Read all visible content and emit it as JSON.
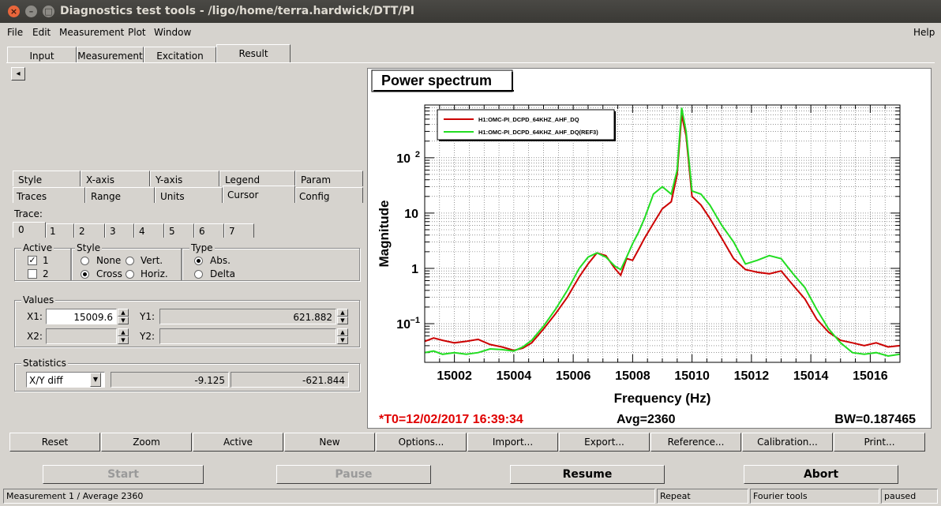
{
  "window": {
    "title": "Diagnostics test tools - /ligo/home/terra.hardwick/DTT/PI"
  },
  "menu": {
    "file": "File",
    "edit": "Edit",
    "measurement": "Measurement",
    "plot": "Plot",
    "window": "Window",
    "help": "Help"
  },
  "main_tabs": [
    "Input",
    "Measurement",
    "Excitation",
    "Result"
  ],
  "left_arrow": "◂",
  "sub_tabs_row1": [
    "Style",
    "X-axis",
    "Y-axis",
    "Legend",
    "Param"
  ],
  "sub_tabs_row2": [
    "Traces",
    "Range",
    "Units",
    "Cursor",
    "Config"
  ],
  "trace": {
    "label": "Trace:",
    "tabs": [
      "0",
      "1",
      "2",
      "3",
      "4",
      "5",
      "6",
      "7"
    ]
  },
  "active": {
    "label": "Active",
    "items": [
      "1",
      "2"
    ]
  },
  "style": {
    "label": "Style",
    "none": "None",
    "vert": "Vert.",
    "cross": "Cross",
    "horiz": "Horiz."
  },
  "type": {
    "label": "Type",
    "abs": "Abs.",
    "delta": "Delta"
  },
  "values": {
    "label": "Values",
    "x1_label": "X1:",
    "x1": "15009.6",
    "y1_label": "Y1:",
    "y1": "621.882",
    "x2_label": "X2:",
    "y2_label": "Y2:"
  },
  "statistics": {
    "label": "Statistics",
    "select": "X/Y diff",
    "v1": "-9.125",
    "v2": "-621.844"
  },
  "chart_data": {
    "type": "line",
    "title": "Power spectrum",
    "xlabel": "Frequency (Hz)",
    "ylabel": "Magnitude",
    "xlim": [
      15001,
      15017
    ],
    "ylim": [
      0.02,
      900
    ],
    "yscale": "log",
    "grid": true,
    "legend_position": "top-left",
    "x_ticks": [
      "15002",
      "15004",
      "15006",
      "15008",
      "15010",
      "15012",
      "15014",
      "15016"
    ],
    "y_ticks": [
      {
        "value": 0.1,
        "base": "10",
        "exp": "−1"
      },
      {
        "value": 1,
        "base": "1",
        "exp": ""
      },
      {
        "value": 10,
        "base": "10",
        "exp": ""
      },
      {
        "value": 100,
        "base": "10",
        "exp": "2"
      }
    ],
    "series": [
      {
        "name": "H1:OMC-PI_DCPD_64KHZ_AHF_DQ",
        "color": "#cc0000",
        "x": [
          15001,
          15001.3,
          15001.6,
          15002,
          15002.4,
          15002.8,
          15003.2,
          15003.6,
          15004,
          15004.3,
          15004.6,
          15005,
          15005.4,
          15005.8,
          15006.2,
          15006.5,
          15006.8,
          15007.1,
          15007.4,
          15007.6,
          15007.8,
          15008,
          15008.2,
          15008.4,
          15008.7,
          15009,
          15009.3,
          15009.5,
          15009.65,
          15009.8,
          15010,
          15010.3,
          15010.6,
          15011,
          15011.4,
          15011.8,
          15012.2,
          15012.6,
          15013,
          15013.4,
          15013.8,
          15014.2,
          15014.6,
          15015,
          15015.4,
          15015.8,
          15016.2,
          15016.6,
          15017
        ],
        "y": [
          0.048,
          0.055,
          0.05,
          0.045,
          0.048,
          0.052,
          0.042,
          0.038,
          0.033,
          0.036,
          0.045,
          0.08,
          0.15,
          0.3,
          0.7,
          1.2,
          1.9,
          1.7,
          1.0,
          0.75,
          1.5,
          1.4,
          2.2,
          3.5,
          6.5,
          12,
          16,
          50,
          600,
          250,
          20,
          14,
          8,
          3.5,
          1.5,
          0.95,
          0.85,
          0.8,
          0.9,
          0.5,
          0.28,
          0.12,
          0.07,
          0.05,
          0.045,
          0.04,
          0.045,
          0.038,
          0.04
        ]
      },
      {
        "name": "H1:OMC-PI_DCPD_64KHZ_AHF_DQ(REF3)",
        "color": "#22dd22",
        "x": [
          15001,
          15001.3,
          15001.6,
          15002,
          15002.4,
          15002.8,
          15003.2,
          15003.6,
          15004,
          15004.3,
          15004.6,
          15005,
          15005.4,
          15005.8,
          15006.2,
          15006.5,
          15006.8,
          15007.1,
          15007.4,
          15007.6,
          15007.8,
          15008,
          15008.2,
          15008.4,
          15008.7,
          15009,
          15009.3,
          15009.5,
          15009.65,
          15009.8,
          15010,
          15010.3,
          15010.6,
          15011,
          15011.4,
          15011.8,
          15012.2,
          15012.6,
          15013,
          15013.4,
          15013.8,
          15014.2,
          15014.6,
          15015,
          15015.4,
          15015.8,
          15016.2,
          15016.6,
          15017
        ],
        "y": [
          0.03,
          0.032,
          0.028,
          0.03,
          0.028,
          0.03,
          0.035,
          0.034,
          0.032,
          0.038,
          0.05,
          0.09,
          0.18,
          0.4,
          1.0,
          1.6,
          1.9,
          1.6,
          1.1,
          0.95,
          1.6,
          2.8,
          4.5,
          8,
          22,
          30,
          22,
          60,
          800,
          300,
          25,
          22,
          14,
          6,
          3,
          1.2,
          1.4,
          1.7,
          1.5,
          0.8,
          0.45,
          0.18,
          0.08,
          0.045,
          0.03,
          0.028,
          0.03,
          0.026,
          0.028
        ]
      }
    ],
    "footer": {
      "t0": "*T0=12/02/2017 16:39:34",
      "avg": "Avg=2360",
      "bw": "BW=0.187465"
    }
  },
  "actions": [
    "Reset",
    "Zoom",
    "Active",
    "New",
    "Options...",
    "Import...",
    "Export...",
    "Reference...",
    "Calibration...",
    "Print..."
  ],
  "run": {
    "start": "Start",
    "pause": "Pause",
    "resume": "Resume",
    "abort": "Abort"
  },
  "statusbar": {
    "left": "Measurement 1 / Average 2360",
    "repeat": "Repeat",
    "tools": "Fourier tools",
    "state": "paused"
  }
}
